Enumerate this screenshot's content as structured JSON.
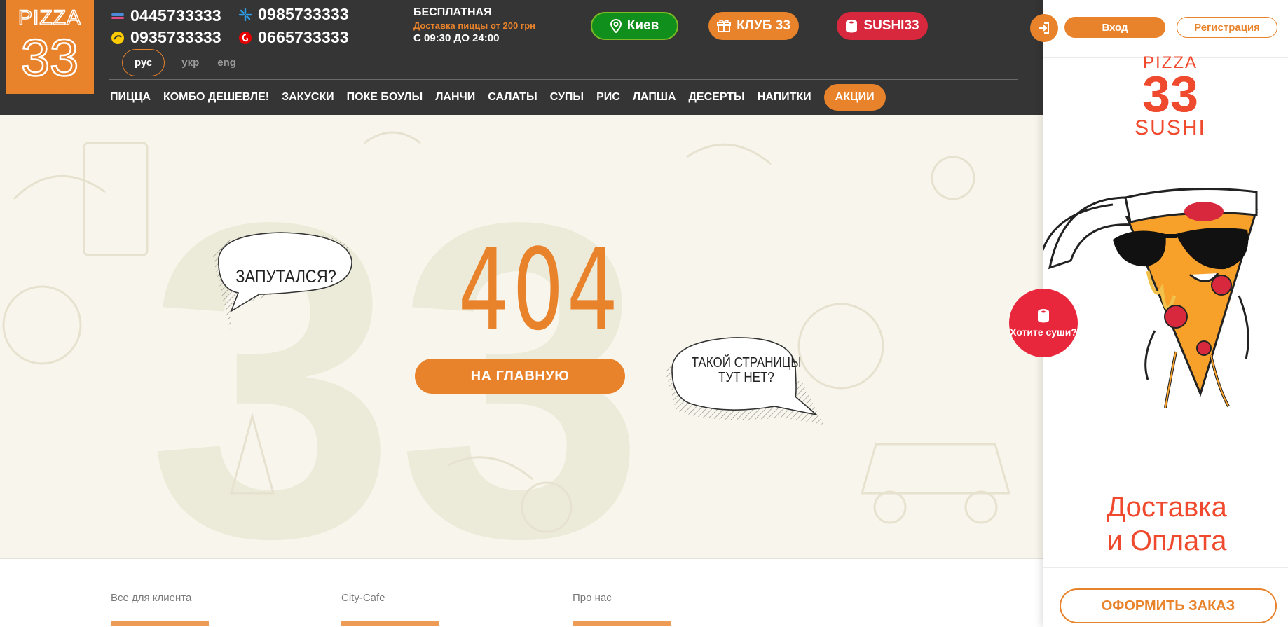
{
  "header": {
    "logo": {
      "text_top": "PIZZA",
      "text_num": "33"
    },
    "phones": [
      {
        "number": "0445733333",
        "operator_icon": "lifecell-icon"
      },
      {
        "number": "0935733333",
        "operator_icon": "lifecell-yellow-icon"
      },
      {
        "number": "0985733333",
        "operator_icon": "kyivstar-icon"
      },
      {
        "number": "0665733333",
        "operator_icon": "vodafone-icon"
      }
    ],
    "delivery": {
      "line1": "БЕСПЛАТНАЯ",
      "line2": "Доставка пиццы от 200 грн",
      "line3": "С 09:30 ДО 24:00"
    },
    "city_label": "Киев",
    "club_label": "КЛУБ 33",
    "sushi_label": "SUSHI33",
    "languages": [
      {
        "label": "рус",
        "active": true
      },
      {
        "label": "укр",
        "active": false
      },
      {
        "label": "eng",
        "active": false
      }
    ],
    "nav": [
      "ПИЦЦА",
      "КОМБО ДЕШЕВЛЕ!",
      "ЗАКУСКИ",
      "ПОКЕ БОУЛЫ",
      "ЛАНЧИ",
      "САЛАТЫ",
      "СУПЫ",
      "РИС",
      "ЛАПША",
      "ДЕСЕРТЫ",
      "НАПИТКИ"
    ],
    "nav_promo": "АКЦИИ"
  },
  "main": {
    "error_code": "404",
    "home_button": "НА ГЛАВНУЮ",
    "bubble_left": "ЗАПУТАЛСЯ?",
    "bubble_right_line1": "ТАКОЙ СТРАНИЦЫ",
    "bubble_right_line2": "ТУТ НЕТ?"
  },
  "footer": {
    "columns": [
      "Все для клиента",
      "City-Cafe",
      "Про нас"
    ]
  },
  "right_panel": {
    "login_label": "Вход",
    "register_label": "Регистрация",
    "logo_line1": "PIZZA",
    "logo_line2": "33",
    "logo_line3": "SUSHI",
    "delivery_title_line1": "Доставка",
    "delivery_title_line2": "и Оплата",
    "order_button": "ОФОРМИТЬ ЗАКАЗ",
    "sushi_prompt": "Хотите суши?"
  },
  "colors": {
    "accent": "#e8822b",
    "header_bg": "#353535",
    "city_green": "#118f1c",
    "sushi_red": "#d8283d",
    "page_bg": "#f8f6ec",
    "brand_red": "#ef4a2e"
  }
}
